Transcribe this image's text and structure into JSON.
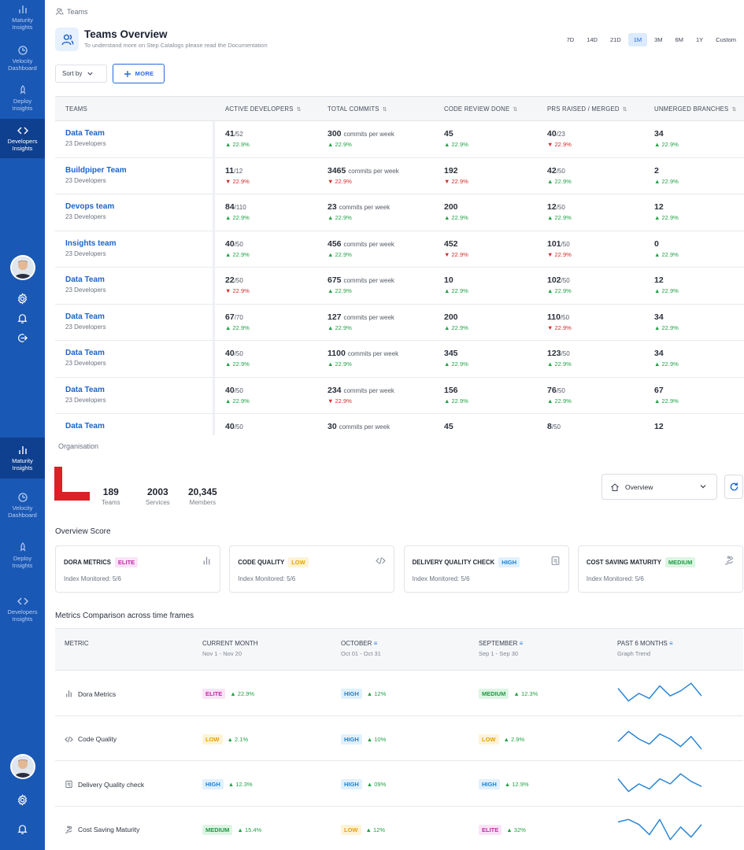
{
  "sidebar": {
    "items": [
      {
        "label_1": "Maturity",
        "label_2": "Insights",
        "icon": "bar-chart-icon"
      },
      {
        "label_1": "Velocity",
        "label_2": "Dashboard",
        "icon": "clock-icon"
      },
      {
        "label_1": "Deploy",
        "label_2": "Insights",
        "icon": "rocket-icon"
      },
      {
        "label_1": "Developers",
        "label_2": "Insights",
        "icon": "code-icon"
      }
    ]
  },
  "teams_page": {
    "breadcrumb": "Teams",
    "title": "Teams Overview",
    "subtitle": "To understand more on Step Catalogs please read the Documentation",
    "timeframes": [
      "7D",
      "14D",
      "21D",
      "1M",
      "3M",
      "6M",
      "1Y",
      "Custom"
    ],
    "active_timeframe": "1M",
    "sort_by": "Sort by",
    "more_button": "MORE",
    "columns": [
      "TEAMS",
      "ACTIVE DEVELOPERS",
      "TOTAL COMMITS",
      "CODE REVIEW DONE",
      "PRS RAISED / MERGED",
      "UNMERGED BRANCHES"
    ],
    "commit_unit": "commits per week",
    "rows": [
      {
        "name": "Data Team",
        "devs": "23 Developers",
        "active": "41",
        "active_total": "/52",
        "active_chg": "22.9%",
        "active_dir": "up",
        "commits": "300",
        "commits_chg": "22.9%",
        "commits_dir": "up",
        "review": "45",
        "review_chg": "22.9%",
        "review_dir": "up",
        "prs": "40",
        "prs_total": "/23",
        "prs_chg": "22.9%",
        "prs_dir": "down",
        "unmerged": "34",
        "unmerged_chg": "22.9%",
        "unmerged_dir": "up"
      },
      {
        "name": "Buildpiper Team",
        "devs": "23 Developers",
        "active": "11",
        "active_total": "/12",
        "active_chg": "22.9%",
        "active_dir": "down",
        "commits": "3465",
        "commits_chg": "22.9%",
        "commits_dir": "down",
        "review": "192",
        "review_chg": "22.9%",
        "review_dir": "down",
        "prs": "42",
        "prs_total": "/50",
        "prs_chg": "22.9%",
        "prs_dir": "up",
        "unmerged": "2",
        "unmerged_chg": "22.9%",
        "unmerged_dir": "up"
      },
      {
        "name": "Devops team",
        "devs": "23 Developers",
        "active": "84",
        "active_total": "/110",
        "active_chg": "22.9%",
        "active_dir": "up",
        "commits": "23",
        "commits_chg": "22.9%",
        "commits_dir": "up",
        "review": "200",
        "review_chg": "22.9%",
        "review_dir": "up",
        "prs": "12",
        "prs_total": "/50",
        "prs_chg": "22.9%",
        "prs_dir": "up",
        "unmerged": "12",
        "unmerged_chg": "22.9%",
        "unmerged_dir": "up"
      },
      {
        "name": "Insights team",
        "devs": "23 Developers",
        "active": "40",
        "active_total": "/50",
        "active_chg": "22.9%",
        "active_dir": "up",
        "commits": "456",
        "commits_chg": "22.9%",
        "commits_dir": "up",
        "review": "452",
        "review_chg": "22.9%",
        "review_dir": "down",
        "prs": "101",
        "prs_total": "/50",
        "prs_chg": "22.9%",
        "prs_dir": "down",
        "unmerged": "0",
        "unmerged_chg": "22.9%",
        "unmerged_dir": "up"
      },
      {
        "name": "Data Team",
        "devs": "23 Developers",
        "active": "22",
        "active_total": "/50",
        "active_chg": "22.9%",
        "active_dir": "down",
        "commits": "675",
        "commits_chg": "22.9%",
        "commits_dir": "up",
        "review": "10",
        "review_chg": "22.9%",
        "review_dir": "up",
        "prs": "102",
        "prs_total": "/50",
        "prs_chg": "22.9%",
        "prs_dir": "up",
        "unmerged": "12",
        "unmerged_chg": "22.9%",
        "unmerged_dir": "up"
      },
      {
        "name": "Data Team",
        "devs": "23 Developers",
        "active": "67",
        "active_total": "/70",
        "active_chg": "22.9%",
        "active_dir": "up",
        "commits": "127",
        "commits_chg": "22.9%",
        "commits_dir": "up",
        "review": "200",
        "review_chg": "22.9%",
        "review_dir": "up",
        "prs": "110",
        "prs_total": "/50",
        "prs_chg": "22.9%",
        "prs_dir": "down",
        "unmerged": "34",
        "unmerged_chg": "22.9%",
        "unmerged_dir": "up"
      },
      {
        "name": "Data Team",
        "devs": "23 Developers",
        "active": "40",
        "active_total": "/50",
        "active_chg": "22.9%",
        "active_dir": "up",
        "commits": "1100",
        "commits_chg": "22.9%",
        "commits_dir": "up",
        "review": "345",
        "review_chg": "22.9%",
        "review_dir": "up",
        "prs": "123",
        "prs_total": "/50",
        "prs_chg": "22.9%",
        "prs_dir": "up",
        "unmerged": "34",
        "unmerged_chg": "22.9%",
        "unmerged_dir": "up"
      },
      {
        "name": "Data Team",
        "devs": "23 Developers",
        "active": "40",
        "active_total": "/50",
        "active_chg": "22.9%",
        "active_dir": "up",
        "commits": "234",
        "commits_chg": "22.9%",
        "commits_dir": "down",
        "review": "156",
        "review_chg": "22.9%",
        "review_dir": "up",
        "prs": "76",
        "prs_total": "/50",
        "prs_chg": "22.9%",
        "prs_dir": "up",
        "unmerged": "67",
        "unmerged_chg": "22.9%",
        "unmerged_dir": "up"
      },
      {
        "name": "Data Team",
        "devs": "",
        "active": "40",
        "active_total": "/50",
        "active_chg": "",
        "active_dir": "up",
        "commits": "30",
        "commits_chg": "",
        "commits_dir": "up",
        "review": "45",
        "review_chg": "",
        "review_dir": "up",
        "prs": "8",
        "prs_total": "/50",
        "prs_chg": "",
        "prs_dir": "up",
        "unmerged": "12",
        "unmerged_chg": "",
        "unmerged_dir": "up"
      }
    ]
  },
  "org_page": {
    "breadcrumb": "Organisation",
    "stats": [
      {
        "value": "189",
        "label": "Teams"
      },
      {
        "value": "2003",
        "label": "Services"
      },
      {
        "value": "20,345",
        "label": "Members"
      }
    ],
    "overview_select": "Overview",
    "overview_score_title": "Overview Score",
    "cards": [
      {
        "title": "DORA METRICS",
        "badge": "ELITE",
        "level": "elite",
        "sub": "Index Monitored: 5/6",
        "icon": "bar-chart-icon"
      },
      {
        "title": "CODE QUALITY",
        "badge": "LOW",
        "level": "low",
        "sub": "Index Monitored: 5/6",
        "icon": "code-icon"
      },
      {
        "title": "DELIVERY QUALITY CHECK",
        "badge": "HIGH",
        "level": "high",
        "sub": "Index Monitored: 5/6",
        "icon": "checklist-icon"
      },
      {
        "title": "COST SAVING MATURITY",
        "badge": "MEDIUM",
        "level": "medium",
        "sub": "Index Monitored: 5/6",
        "icon": "savings-icon"
      }
    ],
    "comparison_title": "Metrics Comparison across time frames",
    "metric_columns": [
      {
        "title": "METRIC",
        "sub": ""
      },
      {
        "title": "CURRENT MONTH",
        "sub": "Nov 1 - Nov 20"
      },
      {
        "title": "OCTOBER",
        "sub": "Oct 01 - Oct 31"
      },
      {
        "title": "SEPTEMBER",
        "sub": "Sep 1 - Sep 30"
      },
      {
        "title": "PAST 6 MONTHS",
        "sub": "Graph Trend"
      }
    ],
    "metrics": [
      {
        "name": "Dora Metrics",
        "icon": "bar-chart-icon",
        "cur": "ELITE",
        "cur_level": "elite",
        "cur_chg": "22.9%",
        "oct": "HIGH",
        "oct_level": "high",
        "oct_chg": "12%",
        "sep": "MEDIUM",
        "sep_level": "medium",
        "sep_chg": "12.3%",
        "trend": [
          7,
          2,
          5,
          3,
          8,
          4,
          6,
          9,
          4
        ]
      },
      {
        "name": "Code Quality",
        "icon": "code-icon",
        "cur": "LOW",
        "cur_level": "low",
        "cur_chg": "2.1%",
        "oct": "HIGH",
        "oct_level": "high",
        "oct_chg": "10%",
        "sep": "LOW",
        "sep_level": "low",
        "sep_chg": "2.9%",
        "trend": [
          4,
          8,
          5,
          3,
          7,
          5,
          2,
          6,
          1
        ]
      },
      {
        "name": "Delivery Quality check",
        "icon": "checklist-icon",
        "cur": "HIGH",
        "cur_level": "high",
        "cur_chg": "12.3%",
        "oct": "HIGH",
        "oct_level": "high",
        "oct_chg": "09%",
        "sep": "HIGH",
        "sep_level": "high",
        "sep_chg": "12.9%",
        "trend": [
          7,
          2,
          5,
          3,
          7,
          5,
          9,
          6,
          4
        ]
      },
      {
        "name": "Cost Saving Maturity",
        "icon": "savings-icon",
        "cur": "MEDIUM",
        "cur_level": "medium",
        "cur_chg": "15.4%",
        "oct": "LOW",
        "oct_level": "low",
        "oct_chg": "12%",
        "sep": "ELITE",
        "sep_level": "elite",
        "sep_chg": "32%",
        "trend": [
          8,
          9,
          7,
          3,
          9,
          1,
          6,
          2,
          7
        ]
      }
    ]
  }
}
